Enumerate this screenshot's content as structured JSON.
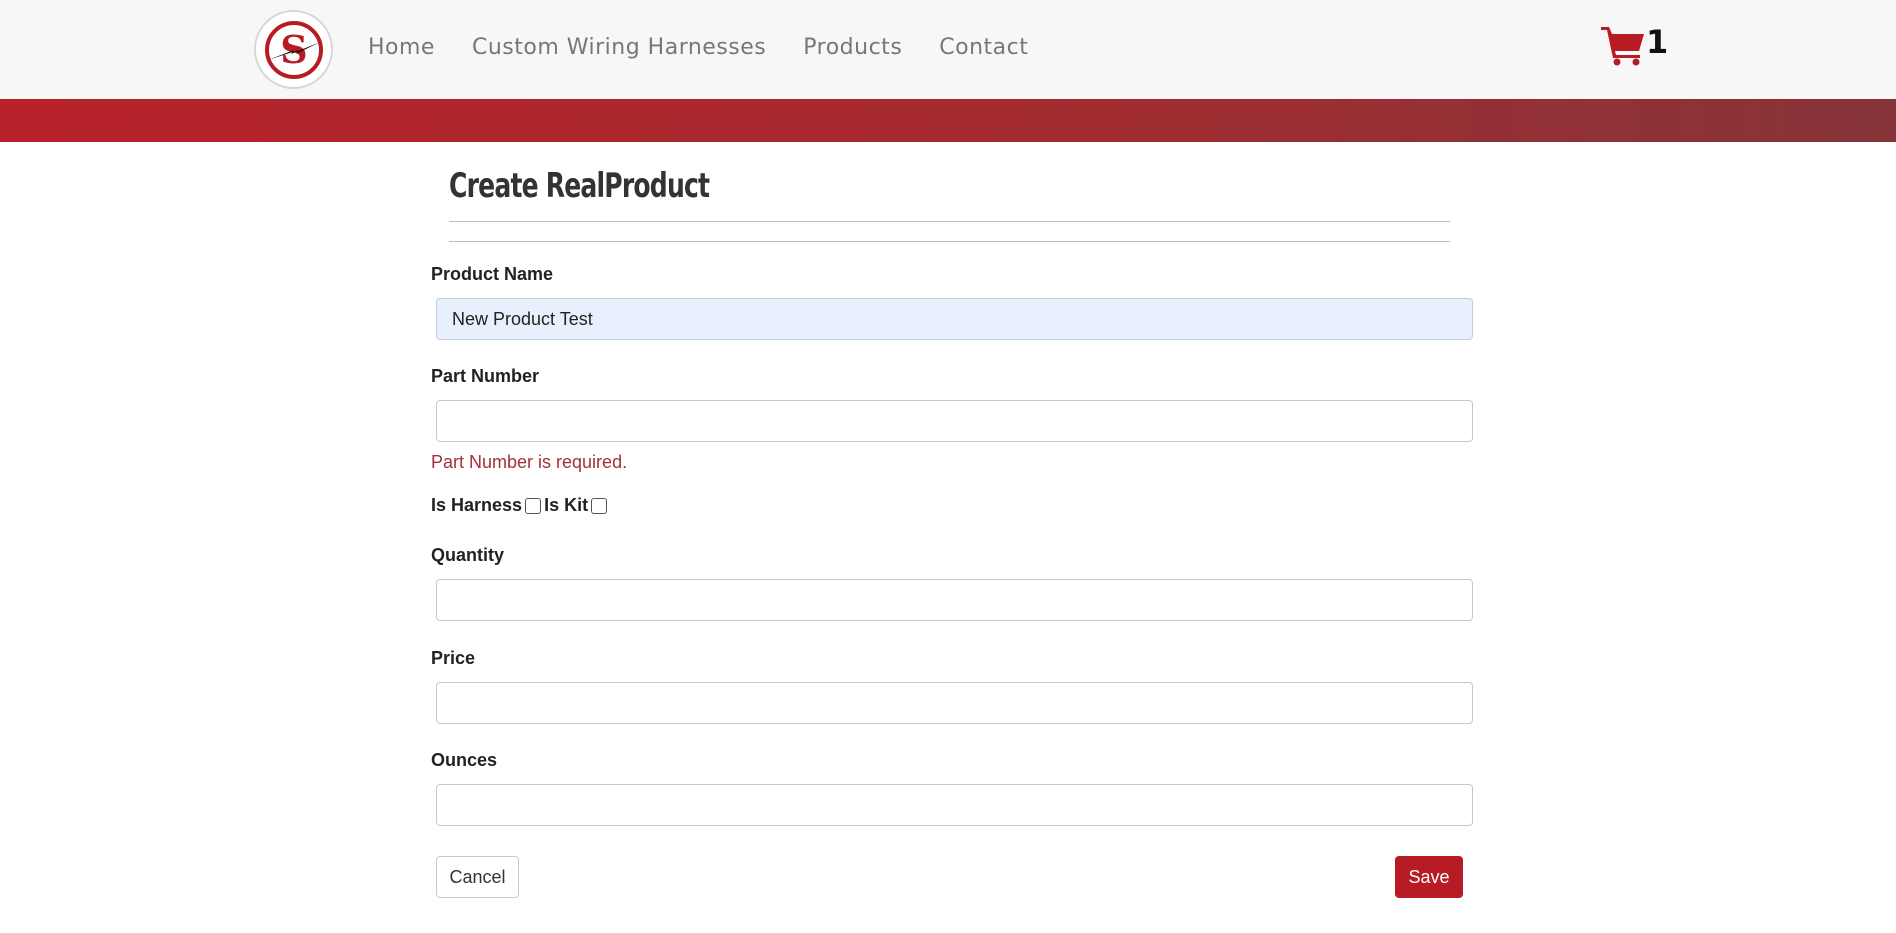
{
  "nav": {
    "logo_letter": "S",
    "links": [
      "Home",
      "Custom Wiring Harnesses",
      "Products",
      "Contact"
    ],
    "cart_count": "1"
  },
  "colors": {
    "brand_red": "#b71c24",
    "band_start": "#b8222a",
    "band_end": "#87353a",
    "error": "#a3303a",
    "autofill_bg": "#e8f0fd"
  },
  "form": {
    "title": "Create RealProduct",
    "product_name": {
      "label": "Product Name",
      "value": "New Product Test"
    },
    "part_number": {
      "label": "Part Number",
      "value": "",
      "error": "Part Number is required."
    },
    "is_harness": {
      "label": "Is Harness",
      "checked": false
    },
    "is_kit": {
      "label": "Is Kit",
      "checked": false
    },
    "quantity": {
      "label": "Quantity",
      "value": ""
    },
    "price": {
      "label": "Price",
      "value": ""
    },
    "ounces": {
      "label": "Ounces",
      "value": ""
    },
    "cancel_label": "Cancel",
    "save_label": "Save"
  },
  "icons": {
    "logo": "lightning-s-logo-icon",
    "cart": "shopping-cart-icon"
  }
}
